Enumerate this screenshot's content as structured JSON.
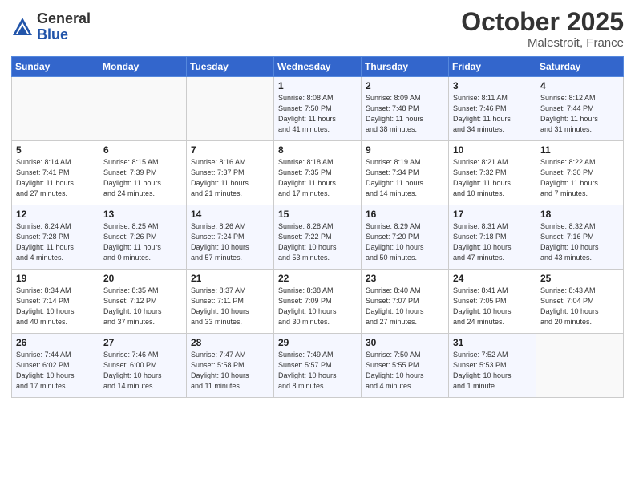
{
  "header": {
    "logo_general": "General",
    "logo_blue": "Blue",
    "month": "October 2025",
    "location": "Malestroit, France"
  },
  "weekdays": [
    "Sunday",
    "Monday",
    "Tuesday",
    "Wednesday",
    "Thursday",
    "Friday",
    "Saturday"
  ],
  "weeks": [
    [
      {
        "day": "",
        "info": ""
      },
      {
        "day": "",
        "info": ""
      },
      {
        "day": "",
        "info": ""
      },
      {
        "day": "1",
        "info": "Sunrise: 8:08 AM\nSunset: 7:50 PM\nDaylight: 11 hours\nand 41 minutes."
      },
      {
        "day": "2",
        "info": "Sunrise: 8:09 AM\nSunset: 7:48 PM\nDaylight: 11 hours\nand 38 minutes."
      },
      {
        "day": "3",
        "info": "Sunrise: 8:11 AM\nSunset: 7:46 PM\nDaylight: 11 hours\nand 34 minutes."
      },
      {
        "day": "4",
        "info": "Sunrise: 8:12 AM\nSunset: 7:44 PM\nDaylight: 11 hours\nand 31 minutes."
      }
    ],
    [
      {
        "day": "5",
        "info": "Sunrise: 8:14 AM\nSunset: 7:41 PM\nDaylight: 11 hours\nand 27 minutes."
      },
      {
        "day": "6",
        "info": "Sunrise: 8:15 AM\nSunset: 7:39 PM\nDaylight: 11 hours\nand 24 minutes."
      },
      {
        "day": "7",
        "info": "Sunrise: 8:16 AM\nSunset: 7:37 PM\nDaylight: 11 hours\nand 21 minutes."
      },
      {
        "day": "8",
        "info": "Sunrise: 8:18 AM\nSunset: 7:35 PM\nDaylight: 11 hours\nand 17 minutes."
      },
      {
        "day": "9",
        "info": "Sunrise: 8:19 AM\nSunset: 7:34 PM\nDaylight: 11 hours\nand 14 minutes."
      },
      {
        "day": "10",
        "info": "Sunrise: 8:21 AM\nSunset: 7:32 PM\nDaylight: 11 hours\nand 10 minutes."
      },
      {
        "day": "11",
        "info": "Sunrise: 8:22 AM\nSunset: 7:30 PM\nDaylight: 11 hours\nand 7 minutes."
      }
    ],
    [
      {
        "day": "12",
        "info": "Sunrise: 8:24 AM\nSunset: 7:28 PM\nDaylight: 11 hours\nand 4 minutes."
      },
      {
        "day": "13",
        "info": "Sunrise: 8:25 AM\nSunset: 7:26 PM\nDaylight: 11 hours\nand 0 minutes."
      },
      {
        "day": "14",
        "info": "Sunrise: 8:26 AM\nSunset: 7:24 PM\nDaylight: 10 hours\nand 57 minutes."
      },
      {
        "day": "15",
        "info": "Sunrise: 8:28 AM\nSunset: 7:22 PM\nDaylight: 10 hours\nand 53 minutes."
      },
      {
        "day": "16",
        "info": "Sunrise: 8:29 AM\nSunset: 7:20 PM\nDaylight: 10 hours\nand 50 minutes."
      },
      {
        "day": "17",
        "info": "Sunrise: 8:31 AM\nSunset: 7:18 PM\nDaylight: 10 hours\nand 47 minutes."
      },
      {
        "day": "18",
        "info": "Sunrise: 8:32 AM\nSunset: 7:16 PM\nDaylight: 10 hours\nand 43 minutes."
      }
    ],
    [
      {
        "day": "19",
        "info": "Sunrise: 8:34 AM\nSunset: 7:14 PM\nDaylight: 10 hours\nand 40 minutes."
      },
      {
        "day": "20",
        "info": "Sunrise: 8:35 AM\nSunset: 7:12 PM\nDaylight: 10 hours\nand 37 minutes."
      },
      {
        "day": "21",
        "info": "Sunrise: 8:37 AM\nSunset: 7:11 PM\nDaylight: 10 hours\nand 33 minutes."
      },
      {
        "day": "22",
        "info": "Sunrise: 8:38 AM\nSunset: 7:09 PM\nDaylight: 10 hours\nand 30 minutes."
      },
      {
        "day": "23",
        "info": "Sunrise: 8:40 AM\nSunset: 7:07 PM\nDaylight: 10 hours\nand 27 minutes."
      },
      {
        "day": "24",
        "info": "Sunrise: 8:41 AM\nSunset: 7:05 PM\nDaylight: 10 hours\nand 24 minutes."
      },
      {
        "day": "25",
        "info": "Sunrise: 8:43 AM\nSunset: 7:04 PM\nDaylight: 10 hours\nand 20 minutes."
      }
    ],
    [
      {
        "day": "26",
        "info": "Sunrise: 7:44 AM\nSunset: 6:02 PM\nDaylight: 10 hours\nand 17 minutes."
      },
      {
        "day": "27",
        "info": "Sunrise: 7:46 AM\nSunset: 6:00 PM\nDaylight: 10 hours\nand 14 minutes."
      },
      {
        "day": "28",
        "info": "Sunrise: 7:47 AM\nSunset: 5:58 PM\nDaylight: 10 hours\nand 11 minutes."
      },
      {
        "day": "29",
        "info": "Sunrise: 7:49 AM\nSunset: 5:57 PM\nDaylight: 10 hours\nand 8 minutes."
      },
      {
        "day": "30",
        "info": "Sunrise: 7:50 AM\nSunset: 5:55 PM\nDaylight: 10 hours\nand 4 minutes."
      },
      {
        "day": "31",
        "info": "Sunrise: 7:52 AM\nSunset: 5:53 PM\nDaylight: 10 hours\nand 1 minute."
      },
      {
        "day": "",
        "info": ""
      }
    ]
  ]
}
